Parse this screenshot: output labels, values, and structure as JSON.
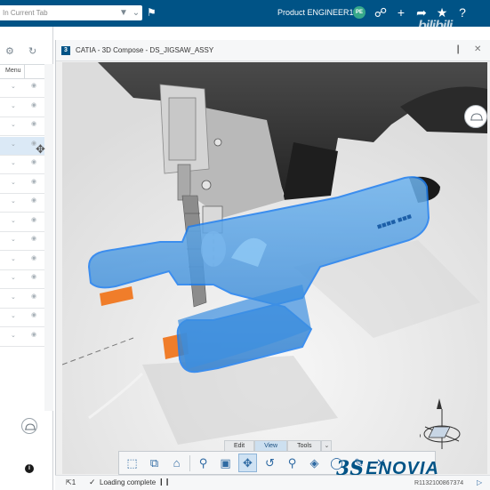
{
  "topbar": {
    "search_placeholder": "In Current Tab",
    "product_name": "Product ENGINEER1",
    "avatar_initials": "PE",
    "watermark": "bilibili"
  },
  "left_panel": {
    "menu_label": "Menu",
    "row_count": 14,
    "selected_row_index": 3
  },
  "app": {
    "title": "CATIA - 3D Compose - DS_JIGSAW_ASSY",
    "logo_letter": "3"
  },
  "toolbar": {
    "tabs": [
      "Edit",
      "View",
      "Tools"
    ],
    "active_tab": "View",
    "buttons": [
      "select-icon",
      "explode-icon",
      "home-view-icon",
      "zoom-icon",
      "cube-view-icon",
      "pan-icon",
      "rotate-icon",
      "zoom-area-icon",
      "view-mode-icon",
      "section-icon",
      "measure-icon",
      "annotate-icon",
      "close-icon"
    ],
    "active_button": "pan-icon"
  },
  "brand": {
    "name": "ENOVIA"
  },
  "statusbar": {
    "selection_count": "1",
    "loading_text": "Loading complete",
    "version": "R1132100867374"
  },
  "colors": {
    "topbar": "#005386",
    "highlight": "#2f8fe0",
    "avatar": "#36a88a"
  }
}
